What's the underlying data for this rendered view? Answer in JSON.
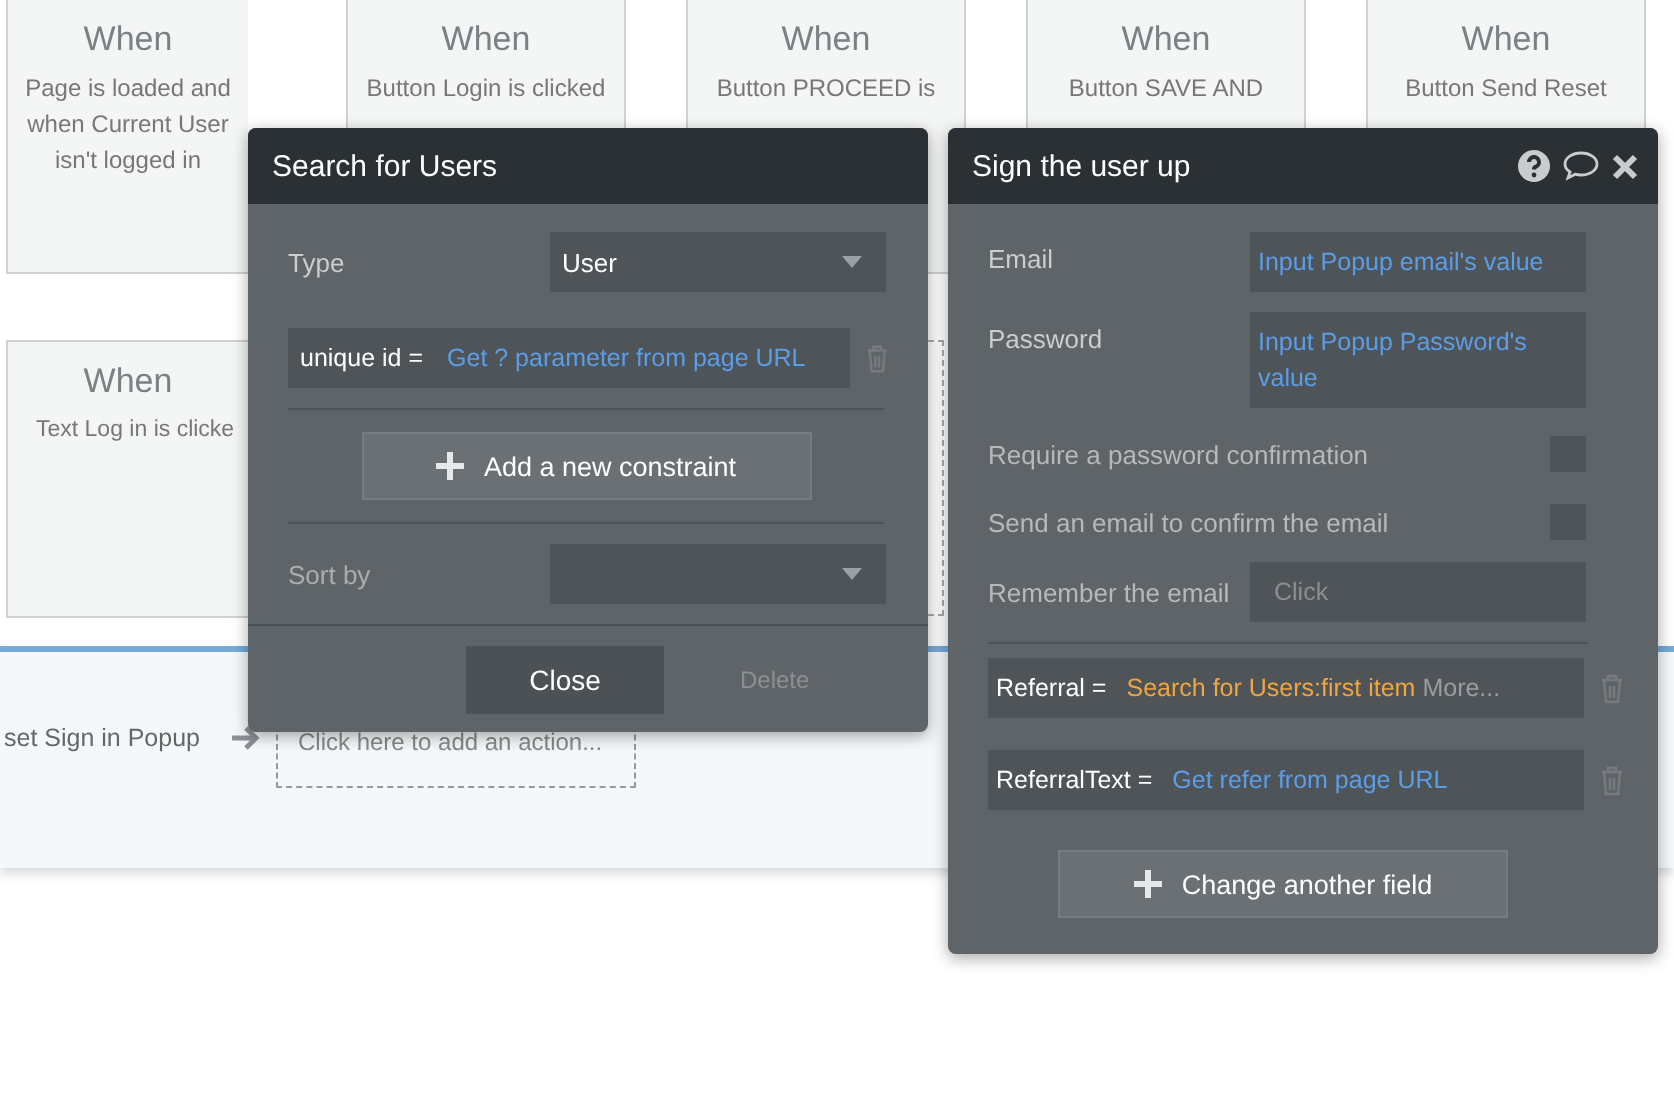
{
  "workflow_cards": [
    {
      "heading": "When",
      "lines": [
        "Page is loaded and",
        "when Current User",
        "isn't logged in"
      ]
    },
    {
      "heading": "When",
      "lines": [
        "Button Login is clicked"
      ]
    },
    {
      "heading": "When",
      "lines": [
        "Button PROCEED is"
      ]
    },
    {
      "heading": "When",
      "lines": [
        "Button SAVE AND"
      ]
    },
    {
      "heading": "When",
      "lines": [
        "Button Send Reset"
      ]
    },
    {
      "heading": "When",
      "lines": [
        "Text Log in is clicke"
      ]
    }
  ],
  "action_bar": {
    "step": "set Sign in Popup",
    "placeholder": "Click here to add an action..."
  },
  "search_popup": {
    "title": "Search for Users",
    "type": {
      "label": "Type",
      "value": "User"
    },
    "constraints": [
      {
        "key": "unique id =",
        "value": "Get ? parameter from page URL"
      }
    ],
    "add_button": "Add a new constraint",
    "sort": {
      "label": "Sort by"
    },
    "close": "Close",
    "delete": {
      "label": "Delete",
      "disabled": true
    }
  },
  "sign_popup": {
    "title": "Sign the user up",
    "rows": [
      {
        "kind": "field",
        "label": "Email",
        "value": "Input Popup email's value"
      },
      {
        "kind": "field",
        "label": "Password",
        "value": "Input Popup Password's value"
      },
      {
        "kind": "checkbox",
        "label": "Require a password confirmation",
        "checked": false
      },
      {
        "kind": "checkbox",
        "label": "Send an email to confirm the email",
        "checked": false
      },
      {
        "kind": "choice",
        "label": "Remember the email",
        "value": "Click"
      }
    ],
    "changes": [
      {
        "field": "Referral =",
        "value": "Search for Users:first item",
        "color": "#f0a640",
        "more": "More..."
      },
      {
        "field": "ReferralText =",
        "value": "Get refer from page URL",
        "color": "#5b9ee8"
      }
    ],
    "add_button": "Change another field"
  }
}
